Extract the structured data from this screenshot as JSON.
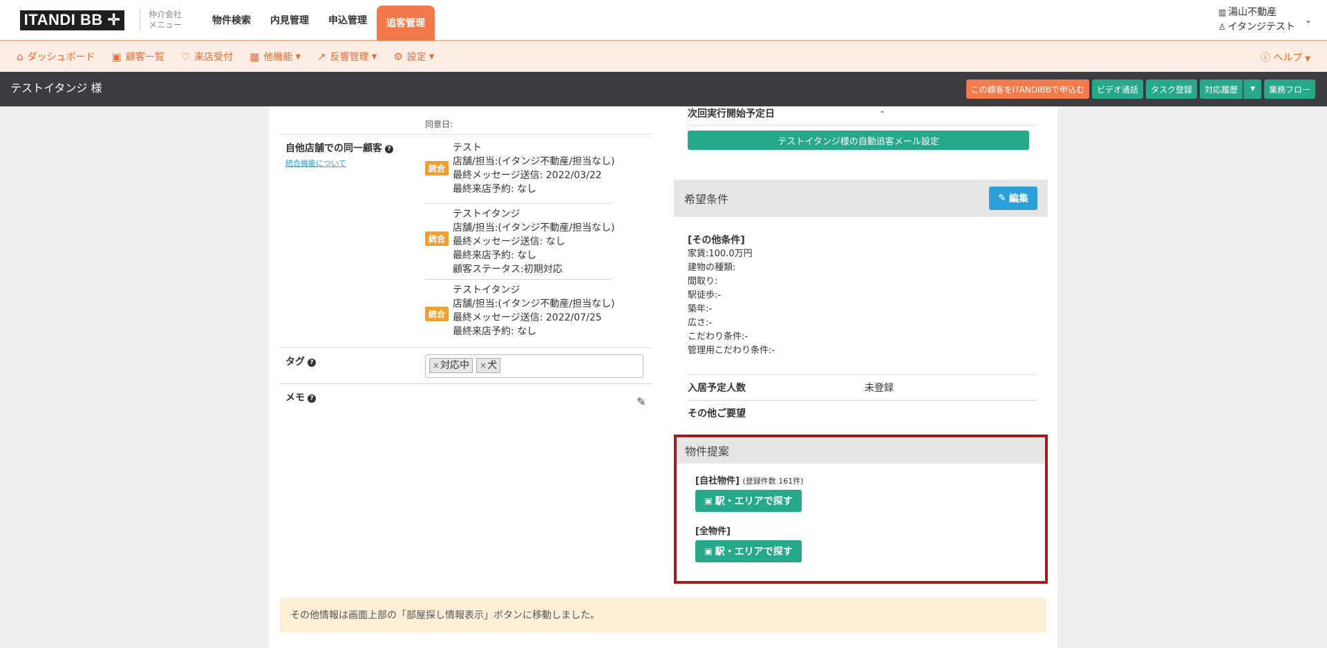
{
  "topnav": {
    "logo": "ITANDI BB ✛",
    "agent_menu_line1": "仲介会社",
    "agent_menu_line2": "メニュー",
    "tabs": [
      "物件検索",
      "内見管理",
      "申込管理",
      "追客管理"
    ],
    "company": "湯山不動産",
    "user": "イタンジテスト"
  },
  "subnav": {
    "items": [
      "ダッシュボード",
      "顧客一覧",
      "来店受付",
      "他機能",
      "反響管理",
      "設定"
    ],
    "help": "ヘルプ"
  },
  "custbar": {
    "name": "テストイタンジ 様",
    "actions": {
      "apply": "この顧客をITANDIBBで申込む",
      "video": "ビデオ通話",
      "task": "タスク登録",
      "history": "対応履歴",
      "flow": "業務フロー"
    }
  },
  "left": {
    "agree_label": "同意日:",
    "dup_label": "自他店舗での同一顧客",
    "dup_link": "統合機能について",
    "badge": "統合",
    "entries": [
      {
        "lines": [
          "テスト",
          "店舗/担当:(イタンジ不動産/担当なし)",
          "最終メッセージ送信: 2022/03/22",
          "最終来店予約: なし"
        ]
      },
      {
        "lines": [
          "テストイタンジ",
          "店舗/担当:(イタンジ不動産/担当なし)",
          "最終メッセージ送信: なし",
          "最終来店予約: なし",
          "顧客ステータス:初期対応"
        ]
      },
      {
        "lines": [
          "テストイタンジ",
          "店舗/担当:(イタンジ不動産/担当なし)",
          "最終メッセージ送信: 2022/07/25",
          "最終来店予約: なし"
        ]
      }
    ],
    "tag_label": "タグ",
    "tags": [
      "対応中",
      "犬"
    ],
    "memo_label": "メモ"
  },
  "right": {
    "next_exec_label": "次回実行開始予定日",
    "next_exec_value": "-",
    "mail_button": "テストイタンジ様の自動追客メール設定",
    "wish_title": "希望条件",
    "edit_button": "編集",
    "other_cond_header": "[その他条件]",
    "conditions": [
      "家賃:100.0万円",
      "建物の種類:",
      "間取り:",
      "駅徒歩:-",
      "築年:-",
      "広さ:-",
      "こだわり条件:-",
      "管理用こだわり条件:-"
    ],
    "occupants_label": "入居予定人数",
    "occupants_value": "未登録",
    "other_request_label": "その他ご要望"
  },
  "proposal": {
    "title": "物件提案",
    "own_label": "[自社物件]",
    "own_count": "(登録件数 161件)",
    "all_label": "[全物件]",
    "search_button": "駅・エリアで探す"
  },
  "notice": "その他情報は画面上部の「部屋探し情報表示」ボタンに移動しました。",
  "colors": {
    "accent": "#f47a4b",
    "green": "#25a98a",
    "blue": "#2a9fd8",
    "highlight": "#a61c1c"
  }
}
